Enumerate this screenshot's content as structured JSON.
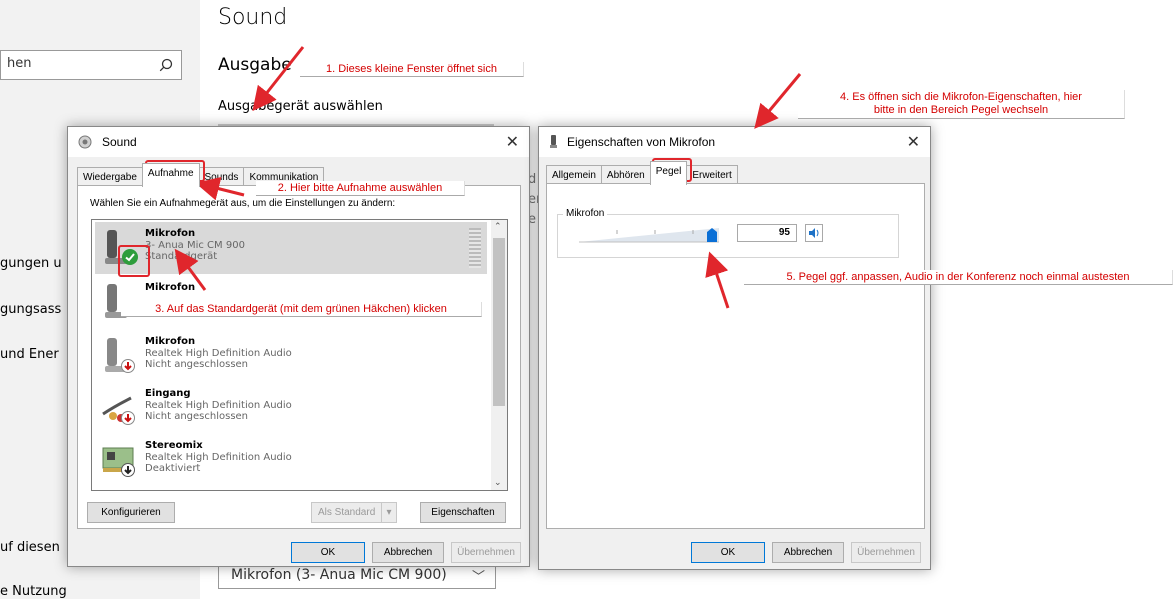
{
  "settings": {
    "search_text": "hen",
    "nav": [
      "gungen u",
      "gungsass",
      "und Ener",
      "uf diesen",
      "e Nutzung"
    ],
    "title": "Sound",
    "section": "Ausgabe",
    "output_label": "Ausgabegerät auswählen",
    "input_device": "Mikrofon (3- Anua Mic CM 900)",
    "behind_chars": [
      "d",
      "er",
      "e"
    ]
  },
  "sound_dialog": {
    "title": "Sound",
    "tabs": [
      "Wiedergabe",
      "Aufnahme",
      "Sounds",
      "Kommunikation"
    ],
    "active_tab": "Aufnahme",
    "instruction": "Wählen Sie ein Aufnahmegerät aus, um die Einstellungen zu ändern:",
    "devices": [
      {
        "name": "Mikrofon",
        "detail": "3- Anua Mic CM 900",
        "status": "Standardgerät",
        "icon": "microphone-icon",
        "badge": "check-icon"
      },
      {
        "name": "Mikrofon",
        "detail": "",
        "status": "",
        "icon": "microphone-icon",
        "badge": ""
      },
      {
        "name": "Mikrofon",
        "detail": "Realtek High Definition Audio",
        "status": "Nicht angeschlossen",
        "icon": "microphone-icon",
        "badge": "down-arrow-icon"
      },
      {
        "name": "Eingang",
        "detail": "Realtek High Definition Audio",
        "status": "Nicht angeschlossen",
        "icon": "cable-icon",
        "badge": "down-arrow-icon"
      },
      {
        "name": "Stereomix",
        "detail": "Realtek High Definition Audio",
        "status": "Deaktiviert",
        "icon": "soundcard-icon",
        "badge": "down-arrow-icon"
      }
    ],
    "btn_configure": "Konfigurieren",
    "btn_default": "Als Standard",
    "btn_properties": "Eigenschaften",
    "btn_ok": "OK",
    "btn_cancel": "Abbrechen",
    "btn_apply": "Übernehmen"
  },
  "mic_dialog": {
    "title": "Eigenschaften von Mikrofon",
    "tabs": [
      "Allgemein",
      "Abhören",
      "Pegel",
      "Erweitert"
    ],
    "active_tab": "Pegel",
    "group_label": "Mikrofon",
    "level_value": "95",
    "level_fraction": 0.95,
    "btn_ok": "OK",
    "btn_cancel": "Abbrechen",
    "btn_apply": "Übernehmen"
  },
  "annotations": {
    "a1": "1. Dieses kleine Fenster öffnet sich",
    "a2": "2. Hier bitte Aufnahme auswählen",
    "a3": "3. Auf das Standardgerät (mit dem grünen Häkchen) klicken",
    "a4_line1": "4. Es öffnen sich die Mikrofon-Eigenschaften, hier",
    "a4_line2": "bitte in den Bereich Pegel wechseln",
    "a5": "5. Pegel ggf. anpassen, Audio in der Konferenz noch einmal austesten"
  },
  "colors": {
    "annotation": "#d40000",
    "accent": "#0078d7",
    "check": "#2e9d3c",
    "warn": "#c91010"
  }
}
